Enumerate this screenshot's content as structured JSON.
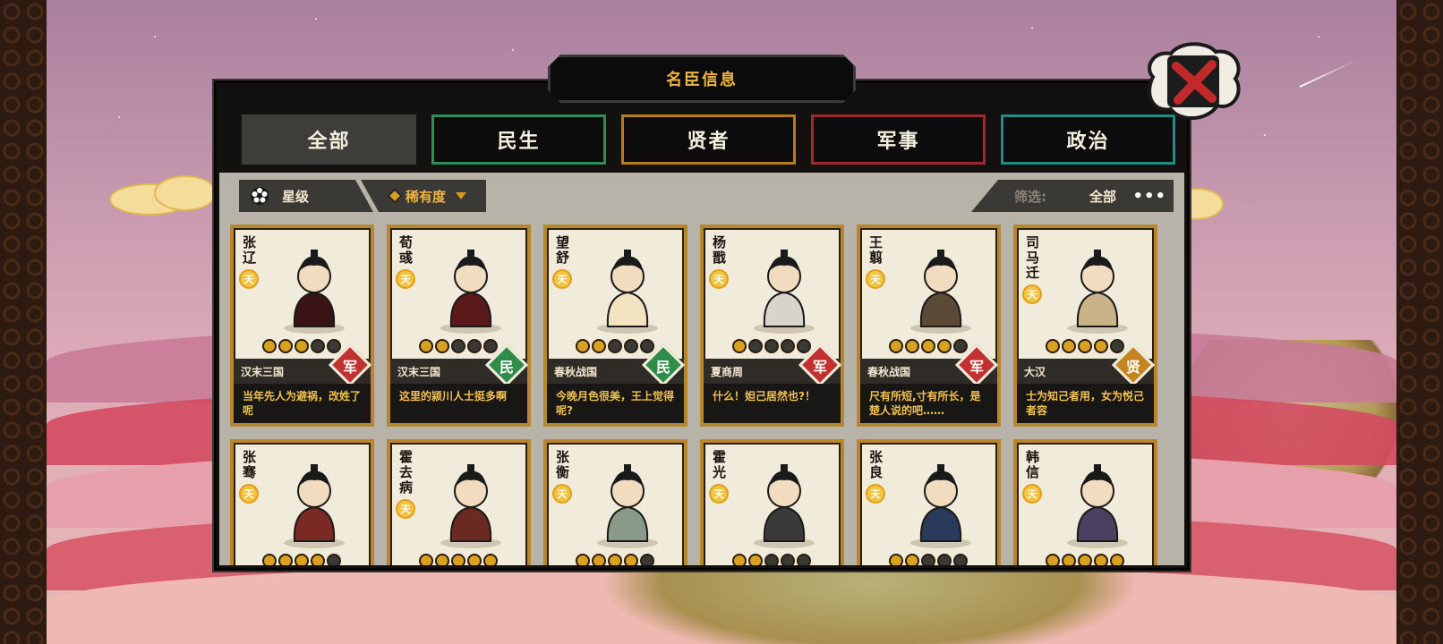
{
  "dialog": {
    "title": "名臣信息"
  },
  "tabs": [
    {
      "label": "全部",
      "color": "#3f3d3a",
      "active": true
    },
    {
      "label": "民生",
      "color": "#2f8d5a",
      "active": false
    },
    {
      "label": "贤者",
      "color": "#b77a1e",
      "active": false
    },
    {
      "label": "军事",
      "color": "#a2282b",
      "active": false
    },
    {
      "label": "政治",
      "color": "#258a86",
      "active": false
    }
  ],
  "toolbar": {
    "star_sort_label": "星级",
    "rarity_sort_label": "稀有度",
    "filter_label": "筛选:",
    "filter_value": "全部",
    "more_label": "•••"
  },
  "type_colors": {
    "军": "#c0312f",
    "民": "#2f8d4a",
    "贤": "#c5851e"
  },
  "rarity_badge": "天",
  "cards": [
    {
      "name": "张辽",
      "stars": 3,
      "era": "汉末三国",
      "type": "军",
      "quote": "当年先人为避祸，改姓了呢"
    },
    {
      "name": "荀彧",
      "stars": 2,
      "era": "汉末三国",
      "type": "民",
      "quote": "这里的颍川人士挺多啊"
    },
    {
      "name": "望舒",
      "stars": 2,
      "era": "春秋战国",
      "type": "民",
      "quote": "今晚月色很美，王上觉得呢?"
    },
    {
      "name": "杨戬",
      "stars": 1,
      "era": "夏商周",
      "type": "军",
      "quote": "什么！妲己居然也?！"
    },
    {
      "name": "王翦",
      "stars": 4,
      "era": "春秋战国",
      "type": "军",
      "quote": "尺有所短,寸有所长，是楚人说的吧……"
    },
    {
      "name": "司马迁",
      "stars": 4,
      "era": "大汉",
      "type": "贤",
      "quote": "士为知己者用，女为悦己者容"
    },
    {
      "name": "张骞",
      "stars": 4,
      "era": "",
      "type": "",
      "quote": ""
    },
    {
      "name": "霍去病",
      "stars": 5,
      "era": "",
      "type": "",
      "quote": ""
    },
    {
      "name": "张衡",
      "stars": 4,
      "era": "",
      "type": "",
      "quote": ""
    },
    {
      "name": "霍光",
      "stars": 2,
      "era": "",
      "type": "",
      "quote": ""
    },
    {
      "name": "张良",
      "stars": 2,
      "era": "",
      "type": "",
      "quote": ""
    },
    {
      "name": "韩信",
      "stars": 5,
      "era": "",
      "type": "",
      "quote": ""
    }
  ]
}
